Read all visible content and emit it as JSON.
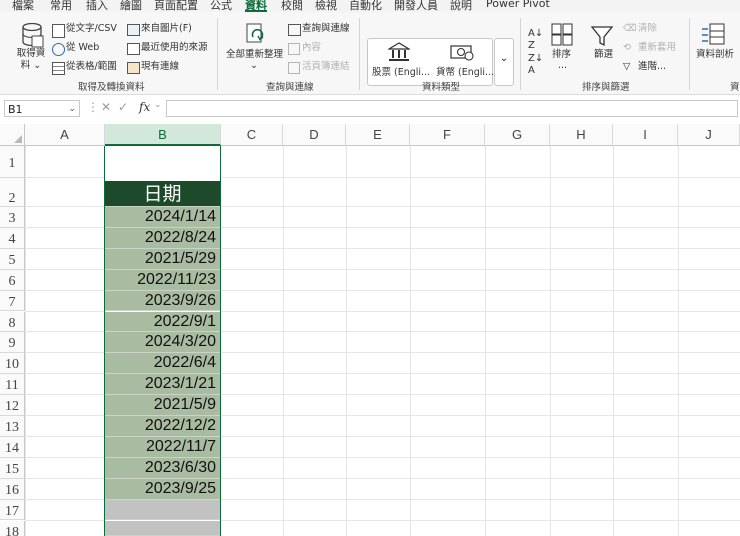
{
  "menu": {
    "tabs": [
      "檔案",
      "常用",
      "插入",
      "繪圖",
      "頁面配置",
      "公式",
      "資料",
      "校閱",
      "檢視",
      "自動化",
      "開發人員",
      "說明",
      "Power Pivot"
    ],
    "active": "資料"
  },
  "ribbon": {
    "get_data": {
      "label_line1": "取得資",
      "label_line2": "料",
      "dropdown": "⌄"
    },
    "from_text_csv": "從文字/CSV",
    "from_web": "從 Web",
    "from_table_range": "從表格/範圍",
    "from_picture": "來自圖片(F)",
    "recent_sources": "最近使用的來源",
    "existing_connections": "現有連線",
    "group_get_transform": "取得及轉換資料",
    "refresh_all": "全部重新整理",
    "queries_connections": "查詢與連線",
    "properties": "內容",
    "edit_links": "活頁簿連結",
    "group_queries": "查詢與連線",
    "stocks": "股票 (Engli...",
    "currencies": "貨幣 (Engli...",
    "group_data_types": "資料類型",
    "sort": "排序",
    "sort_dots": "...",
    "filter": "篩選",
    "clear": "清除",
    "reapply": "重新套用",
    "advanced": "進階...",
    "group_sort_filter": "排序與篩選",
    "data_analysis": "資料剖析",
    "group_data_tools": "資"
  },
  "formula_bar": {
    "name_box": "B1",
    "fx": "fx",
    "value": ""
  },
  "columns": [
    "A",
    "B",
    "C",
    "D",
    "E",
    "F",
    "G",
    "H",
    "I",
    "J"
  ],
  "selected_column": "B",
  "rows": [
    "1",
    "2",
    "3",
    "4",
    "5",
    "6",
    "7",
    "8",
    "9",
    "10",
    "11",
    "12",
    "13",
    "14",
    "15",
    "16",
    "17",
    "18"
  ],
  "column_b": {
    "header": "日期",
    "dates": [
      "2024/1/14",
      "2022/8/24",
      "2021/5/29",
      "2022/11/23",
      "2023/9/26",
      "2022/9/1",
      "2024/3/20",
      "2022/6/4",
      "2023/1/21",
      "2021/5/9",
      "2022/12/2",
      "2022/11/7",
      "2023/6/30",
      "2023/9/25"
    ]
  },
  "colors": {
    "accent": "#0d6b3a",
    "header_fill": "#1d4a2a",
    "date_fill": "#a9bba1",
    "blank_fill": "#c2c2c2"
  }
}
